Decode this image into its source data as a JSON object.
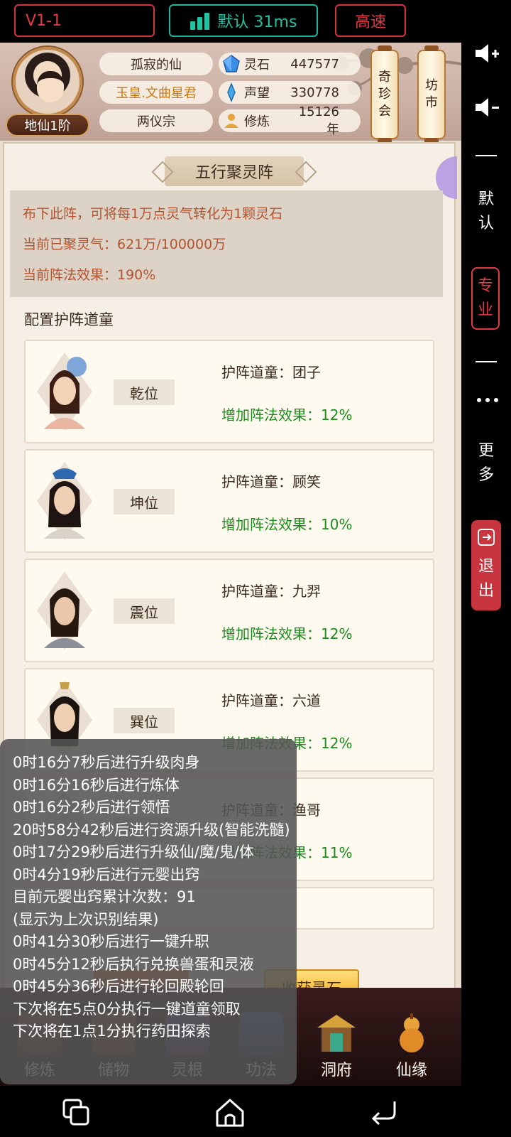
{
  "topbar": {
    "version": "V1-1",
    "network": "默认 31ms",
    "speed": "高速"
  },
  "player": {
    "rank": "地仙1阶",
    "name": "孤寂的仙",
    "title": "玉皇.文曲星君",
    "sect": "两仪宗",
    "stats": [
      {
        "label": "灵石",
        "value": "447577",
        "icon": "spirit-stone-icon"
      },
      {
        "label": "声望",
        "value": "330778",
        "icon": "prestige-icon"
      },
      {
        "label": "修炼",
        "value": "15126年",
        "icon": "cultivation-icon"
      }
    ]
  },
  "lanterns": {
    "treasure": [
      "奇",
      "珍",
      "会"
    ],
    "market": [
      "坊",
      "市"
    ]
  },
  "panel": {
    "title": "五行聚灵阵",
    "description": "布下此阵，可将每1万点灵气转化为1颗灵石",
    "gathered": "当前已聚灵气：621万/100000万",
    "effect": "当前阵法效果：190%",
    "section_label": "配置护阵道童",
    "harvest_label": "收获灵石"
  },
  "guardians": [
    {
      "position": "乾位",
      "guard": "护阵道童：团子",
      "bonus": "增加阵法效果：12%"
    },
    {
      "position": "坤位",
      "guard": "护阵道童：顾笑",
      "bonus": "增加阵法效果：10%"
    },
    {
      "position": "震位",
      "guard": "护阵道童：九羿",
      "bonus": "增加阵法效果：12%"
    },
    {
      "position": "巽位",
      "guard": "护阵道童：六道",
      "bonus": "增加阵法效果：12%"
    },
    {
      "position": "",
      "guard": "护阵道童：渔哥",
      "bonus": "增加阵法效果：11%"
    }
  ],
  "bottom_nav": [
    {
      "label": "修炼"
    },
    {
      "label": "储物"
    },
    {
      "label": "灵根"
    },
    {
      "label": "功法"
    },
    {
      "label": "洞府"
    },
    {
      "label": "仙缘"
    }
  ],
  "log": [
    "0时16分7秒后进行升级肉身",
    "0时16分16秒后进行炼体",
    "0时16分2秒后进行领悟",
    "20时58分42秒后进行资源升级(智能洗髓)",
    "0时17分29秒后进行升级仙/魔/鬼/体",
    "0时4分19秒后进行元婴出窍",
    "目前元婴出窍累计次数：91",
    "(显示为上次识别结果)",
    "0时41分30秒后进行一键升职",
    "0时45分12秒后执行兑换兽蛋和灵液",
    "0时45分36秒后进行轮回殿轮回",
    "下次将在5点0分执行一键道童领取",
    "下次将在1点1分执行药田探索"
  ],
  "right_panel": {
    "default_chars": [
      "默",
      "认"
    ],
    "pro_chars": [
      "专",
      "业"
    ],
    "more_chars": [
      "更",
      "多"
    ],
    "exit_chars": [
      "退",
      "出"
    ]
  },
  "colors": {
    "accent_red": "#e23a44",
    "accent_teal": "#21c2a2",
    "bonus_green": "#1c8a1c",
    "info_orange": "#b4532f"
  }
}
